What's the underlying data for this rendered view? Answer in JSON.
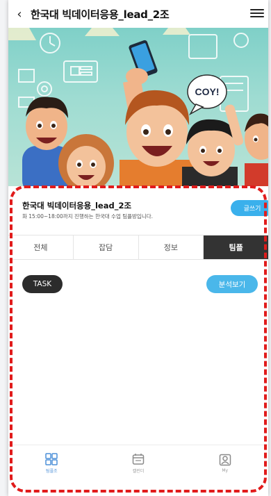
{
  "header": {
    "back_icon": "chevron-left-icon",
    "title": "한국대 빅데이터응용_lead_2조",
    "menu_icon": "hamburger-menu-icon"
  },
  "hero": {
    "speech_bubble": "COY!"
  },
  "room": {
    "title": "한국대 빅데이터응용_lead_2조",
    "description": "화 15:00~18:00까지 진행하는 한국대 수업 팀플방입니다.",
    "write_button": "글쓰기"
  },
  "tabs": [
    {
      "label": "전체",
      "active": false
    },
    {
      "label": "잡담",
      "active": false
    },
    {
      "label": "정보",
      "active": false
    },
    {
      "label": "팀플",
      "active": true
    }
  ],
  "task_chip": "TASK",
  "analysis_button": "분석보기",
  "bottom_nav": [
    {
      "label": "팀플조",
      "icon": "grid-icon",
      "active": true
    },
    {
      "label": "캘린더",
      "icon": "calendar-icon",
      "active": false
    },
    {
      "label": "My",
      "icon": "profile-icon",
      "active": false
    }
  ],
  "colors": {
    "accent": "#3ab0ec",
    "tab_active": "#333333",
    "highlight": "#e11b1b",
    "nav_active": "#4b8fd8"
  }
}
